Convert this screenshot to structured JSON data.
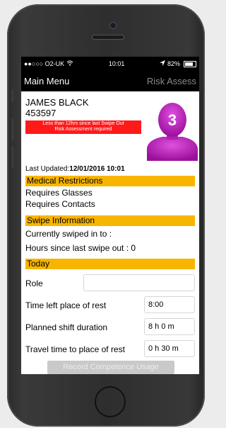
{
  "status": {
    "carrier": "●●○○○ O2-UK",
    "wifi_icon": "wifi-icon",
    "time": "10:01",
    "battery": "82%"
  },
  "nav": {
    "back_label": "Main Menu",
    "action_label": "Risk Assess"
  },
  "person": {
    "name": "JAMES BLACK",
    "id": "453597",
    "alert_line1": "Less than 12hrs since last Swipe Out",
    "alert_line2": "Risk Assessment required",
    "avatar_badge": "3"
  },
  "last_updated": {
    "label": "Last Updated:",
    "value": "12/01/2016 10:01"
  },
  "medical": {
    "title": "Medical Restrictions",
    "items": [
      "Requires Glasses",
      "Requires Contacts"
    ]
  },
  "swipe": {
    "title": "Swipe Information",
    "swiped_in": "Currently swiped in to :",
    "hours_since": "Hours since last swipe out : 0"
  },
  "today": {
    "title": "Today",
    "role_label": "Role",
    "role_value": "",
    "time_left_label": "Time left place of rest",
    "time_left_value": "8:00",
    "planned_label": "Planned shift duration",
    "planned_value": "8 h  0 m",
    "travel_label": "Travel time to place of rest",
    "travel_value": "0 h 30 m"
  },
  "record_button": "Record Competence Usage",
  "colors": {
    "section": "#f7b500",
    "alert": "#ff1a1a",
    "avatar": "#c020c0"
  }
}
